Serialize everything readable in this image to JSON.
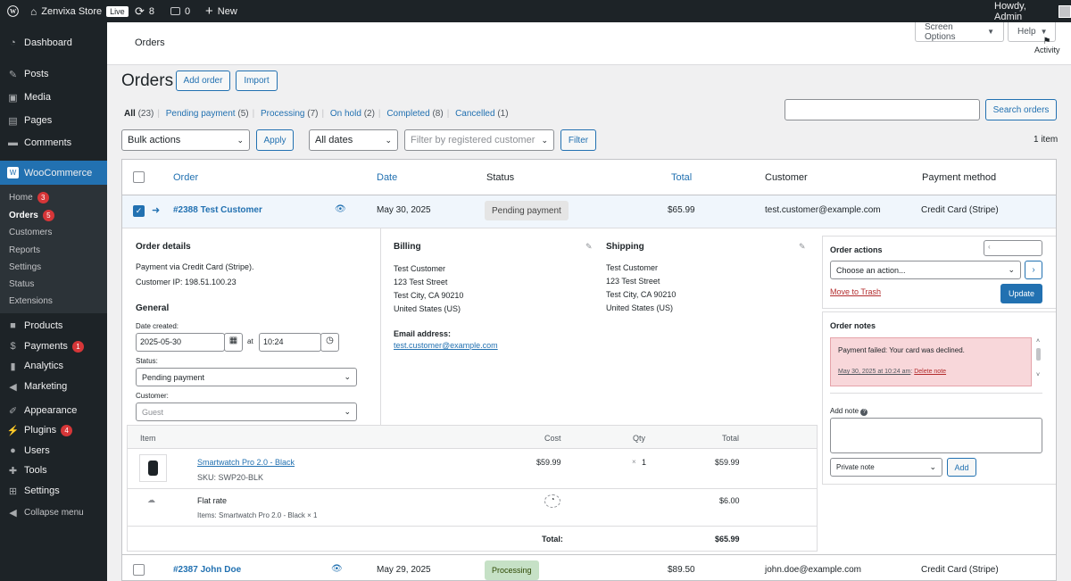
{
  "admin_bar": {
    "site_name": "Zenvixa Store",
    "live_badge": "Live",
    "updates_count": "8",
    "comments_count": "0",
    "new_label": "New",
    "howdy": "Howdy, Admin"
  },
  "sidebar": {
    "dashboard": "Dashboard",
    "posts": "Posts",
    "media": "Media",
    "pages": "Pages",
    "comments": "Comments",
    "woocommerce": "WooCommerce",
    "sub": {
      "home": "Home",
      "home_count": "3",
      "orders": "Orders",
      "orders_count": "5",
      "customers": "Customers",
      "reports": "Reports",
      "settings": "Settings",
      "status": "Status",
      "extensions": "Extensions"
    },
    "products": "Products",
    "payments": "Payments",
    "payments_count": "1",
    "analytics": "Analytics",
    "marketing": "Marketing",
    "appearance": "Appearance",
    "plugins": "Plugins",
    "plugins_count": "4",
    "users": "Users",
    "tools": "Tools",
    "settings": "Settings",
    "collapse": "Collapse menu"
  },
  "topbar": {
    "title": "Orders",
    "screen_options": "Screen Options",
    "help": "Help",
    "activity": "Activity"
  },
  "heading": {
    "title": "Orders",
    "add_order": "Add order",
    "import": "Import"
  },
  "filters": {
    "all": "All",
    "all_count": "(23)",
    "pending": "Pending payment",
    "pending_count": "(5)",
    "processing": "Processing",
    "processing_count": "(7)",
    "on_hold": "On hold",
    "on_hold_count": "(2)",
    "completed": "Completed",
    "completed_count": "(8)",
    "cancelled": "Cancelled",
    "cancelled_count": "(1)"
  },
  "search": {
    "button": "Search orders",
    "value": ""
  },
  "toolbar": {
    "bulk_actions": "Bulk actions",
    "apply": "Apply",
    "all_dates": "All dates",
    "customer_placeholder": "Filter by registered customer",
    "filter": "Filter",
    "item_count": "1 item"
  },
  "table": {
    "headers": {
      "order": "Order",
      "date": "Date",
      "status": "Status",
      "total": "Total",
      "customer": "Customer",
      "payment": "Payment method"
    },
    "rows": [
      {
        "order": "#2388 Test Customer",
        "date": "May 30, 2025",
        "status": "Pending payment",
        "total": "$65.99",
        "customer": "test.customer@example.com",
        "payment": "Credit Card (Stripe)",
        "checked": true
      },
      {
        "order": "#2387 John Doe",
        "date": "May 29, 2025",
        "status": "Processing",
        "total": "$89.50",
        "customer": "john.doe@example.com",
        "payment": "Credit Card (Stripe)",
        "checked": false
      }
    ]
  },
  "preview": {
    "details": {
      "title": "Order details",
      "payment_via": "Payment via Credit Card (Stripe).",
      "customer_ip": "Customer IP: 198.51.100.23",
      "general": "General",
      "date_created_label": "Date created:",
      "date_value": "2025-05-30",
      "at": "at",
      "time_value": "10:24",
      "status_label": "Status:",
      "status_value": "Pending payment",
      "customer_label": "Customer:",
      "customer_value": "Guest"
    },
    "billing": {
      "title": "Billing",
      "lines": [
        "Test Customer",
        "123 Test Street",
        "Test City, CA 90210",
        "United States (US)"
      ],
      "email_label": "Email address:",
      "email": "test.customer@example.com"
    },
    "shipping": {
      "title": "Shipping",
      "lines": [
        "Test Customer",
        "123 Test Street",
        "Test City, CA 90210",
        "United States (US)"
      ]
    },
    "items": {
      "headers": {
        "item": "Item",
        "cost": "Cost",
        "qty": "Qty",
        "total": "Total"
      },
      "product_name": "Smartwatch Pro 2.0 - Black",
      "sku": "SKU: SWP20-BLK",
      "cost": "$59.99",
      "qty_x": "×",
      "qty": "1",
      "line_total": "$59.99",
      "shipping_name": "Flat rate",
      "shipping_items": "Items: Smartwatch Pro 2.0 - Black × 1",
      "shipping_total": "$6.00",
      "total_label": "Total:",
      "total_value": "$65.99"
    },
    "actions": {
      "title": "Order actions",
      "choose": "Choose an action...",
      "move_trash": "Move to Trash",
      "update": "Update"
    },
    "notes": {
      "title": "Order notes",
      "note_text": "Payment failed: Your card was declined.",
      "note_meta": "May 30, 2025 at 10:24 am",
      "delete": "Delete note",
      "add_note_label": "Add note",
      "note_type": "Private note",
      "add": "Add"
    }
  },
  "colors": {
    "admin_dark": "#1d2327",
    "wp_blue": "#2271b1",
    "pending_bg": "#e5e5e5",
    "processing_bg": "#c6e1c6",
    "note_failed_bg": "#f8d7da",
    "badge_red": "#d63638"
  }
}
